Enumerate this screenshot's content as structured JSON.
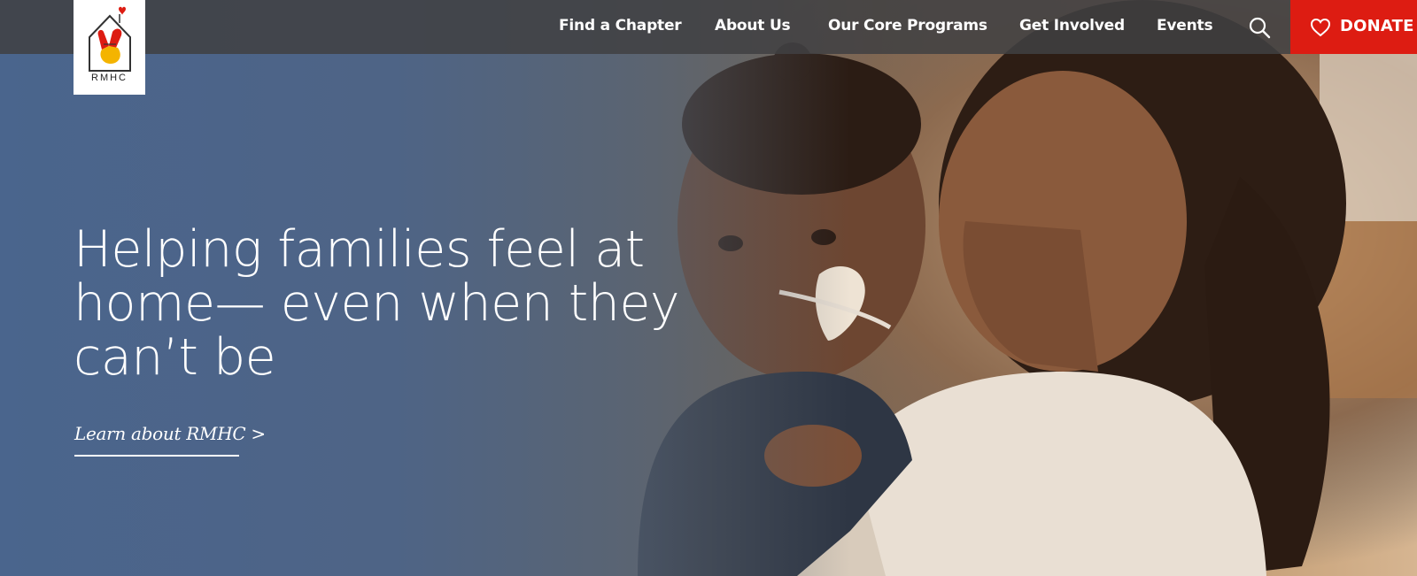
{
  "brand": {
    "logo_text": "RMHC"
  },
  "nav": {
    "items": [
      {
        "label": "Find a Chapter"
      },
      {
        "label": "About Us"
      },
      {
        "label": "Our Core Programs"
      },
      {
        "label": "Get Involved"
      },
      {
        "label": "Events"
      }
    ],
    "search_icon": "search-icon",
    "donate": {
      "label": "DONATE",
      "icon": "heart-icon",
      "color": "#dd1c12"
    }
  },
  "hero": {
    "headline_lines": [
      "Helping families feel at",
      "home— even when they",
      "can’t be"
    ],
    "cta_label": "Learn about RMHC >",
    "image_description_icon": "hero-photo"
  },
  "colors": {
    "navbar": "#404042",
    "hero_blue": "#4b658d",
    "accent_red": "#dd1c12",
    "text": "#ffffff"
  }
}
